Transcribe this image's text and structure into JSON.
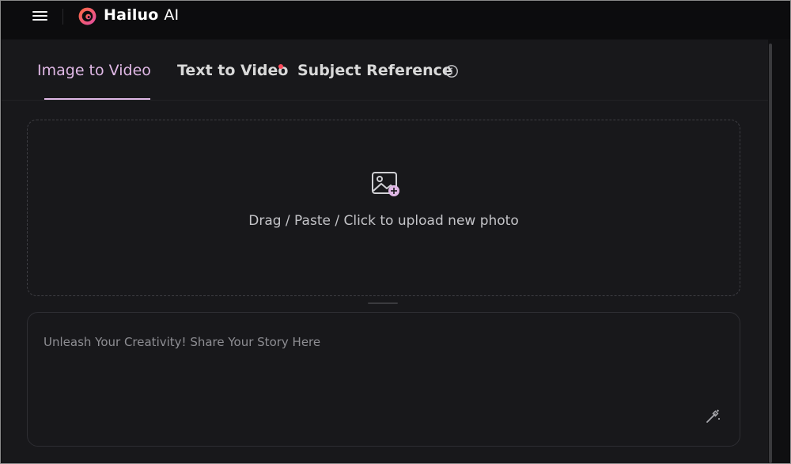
{
  "app": {
    "logo_name": "Hailuo",
    "logo_suffix": "AI"
  },
  "tabs": [
    {
      "label": "Image to Video",
      "active": true
    },
    {
      "label": "Text to Video",
      "badge": true
    },
    {
      "label": "Subject Reference",
      "info_icon": true
    }
  ],
  "upload": {
    "label": "Drag / Paste / Click to upload new photo",
    "icon": "image-add-icon"
  },
  "prompt": {
    "placeholder": "Unleash Your Creativity! Share Your Story Here",
    "icon": "magic-wand-icon"
  },
  "colors": {
    "accent": "#e0b8e6",
    "badge": "#ff4b5c",
    "background": "#18181b"
  }
}
